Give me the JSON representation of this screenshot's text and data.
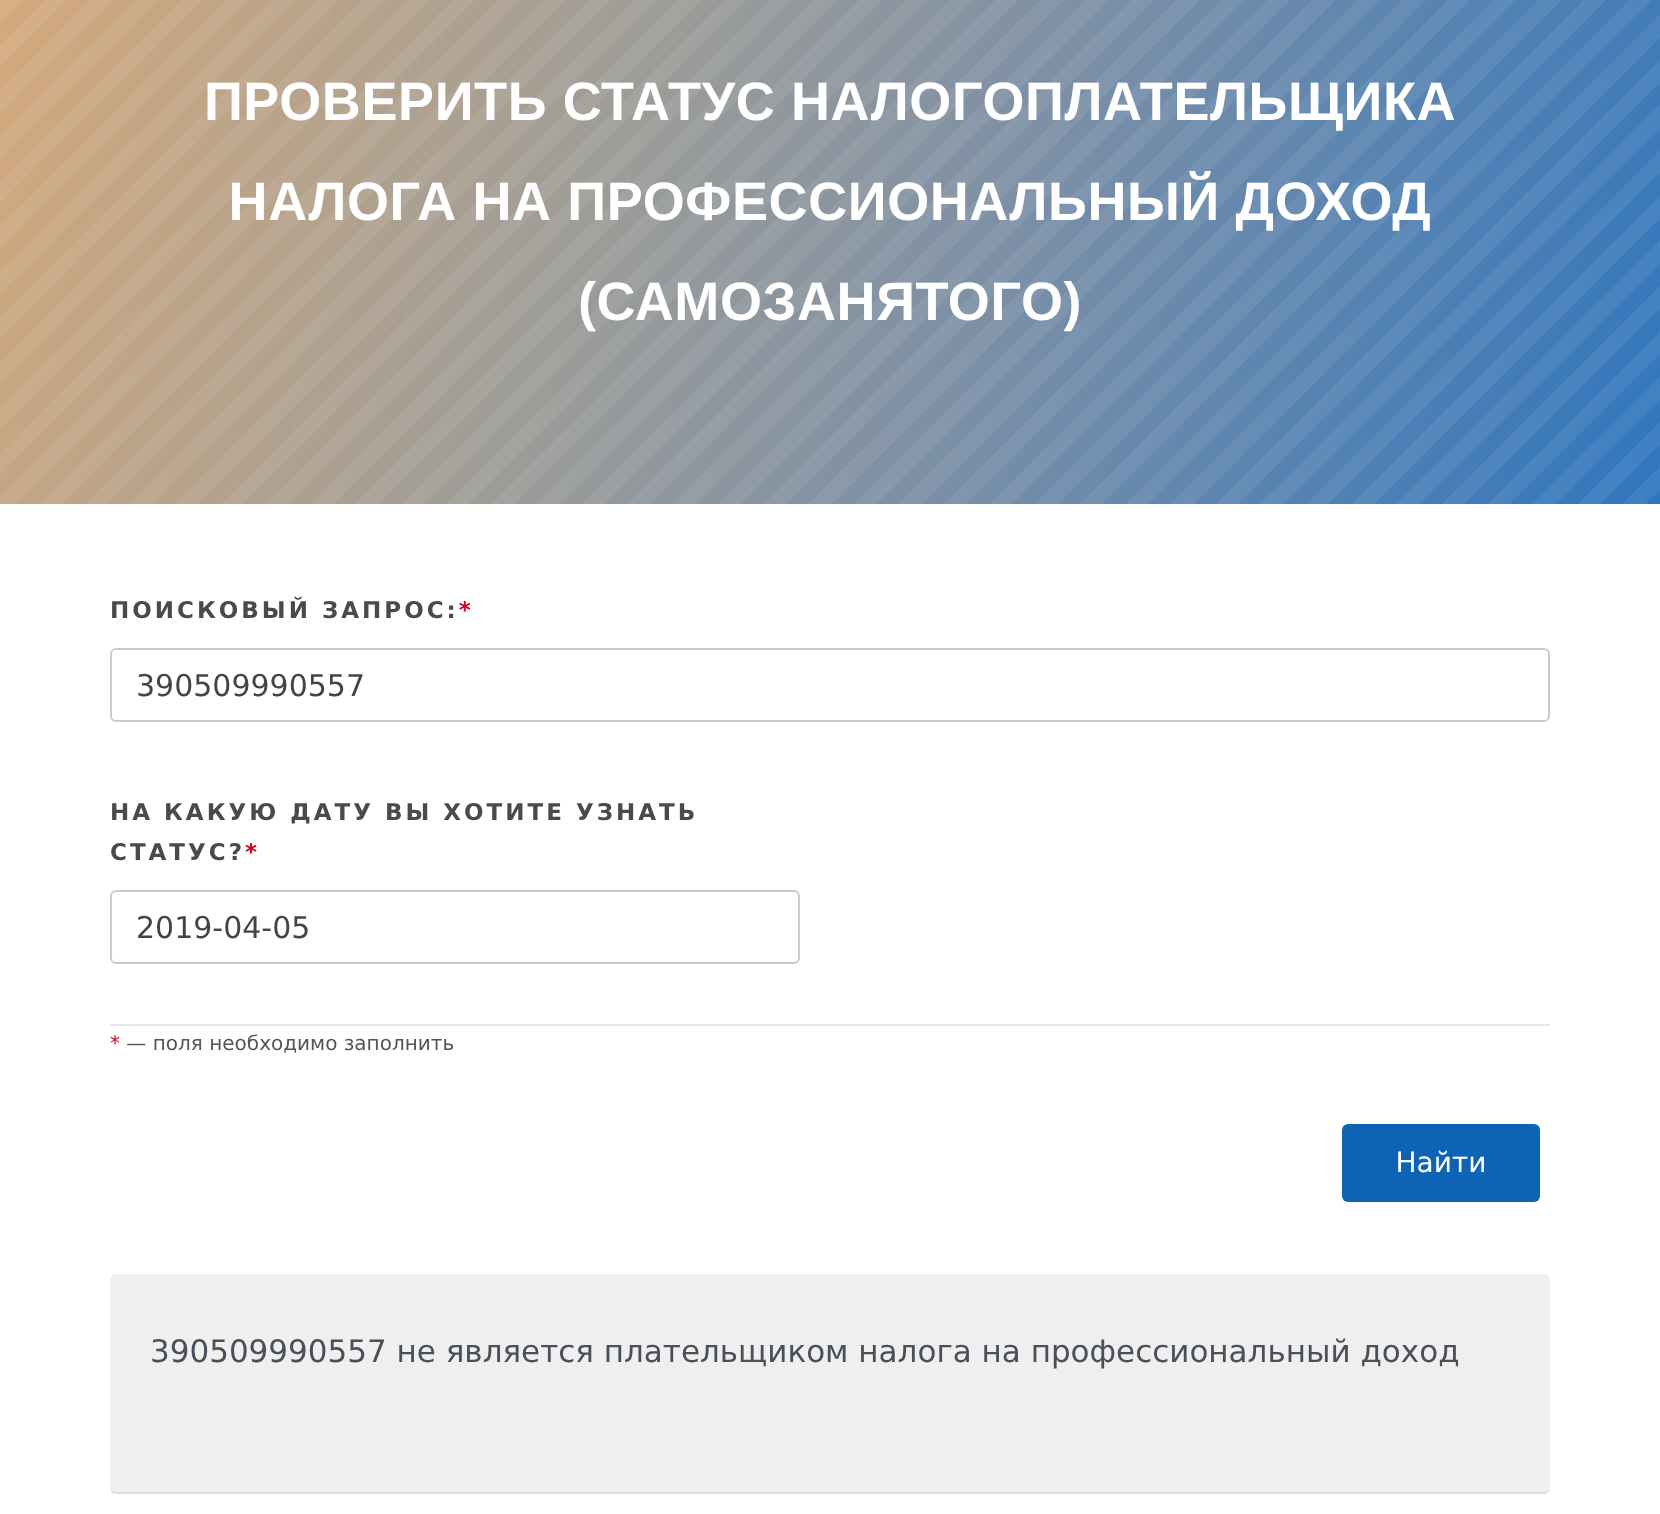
{
  "header": {
    "title_lines": [
      "ПРОВЕРИТЬ СТАТУС НАЛОГОПЛАТЕЛЬЩИКА",
      "НАЛОГА НА ПРОФЕССИОНАЛЬНЫЙ ДОХОД",
      "(САМОЗАНЯТОГО)"
    ]
  },
  "form": {
    "fields": [
      {
        "label": "ПОИСКОВЫЙ ЗАПРОС:",
        "required_mark": "*",
        "value": "390509990557",
        "kind": "wide"
      },
      {
        "label": "НА КАКУЮ ДАТУ ВЫ ХОТИТЕ УЗНАТЬ СТАТУС?",
        "required_mark": "*",
        "value": "2019-04-05",
        "kind": "narrow"
      }
    ],
    "note_mark": "*",
    "note": "— поля необходимо заполнить",
    "submit": "Найти"
  },
  "result": {
    "message": "390509990557 не является плательщиком налога на профессиональный доход"
  }
}
